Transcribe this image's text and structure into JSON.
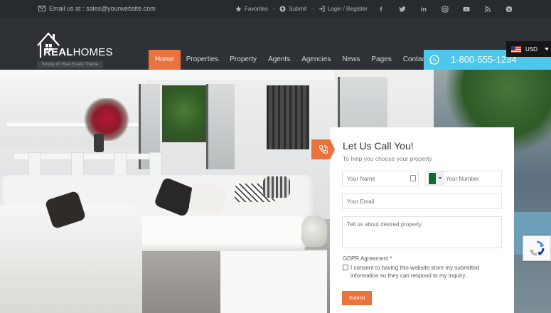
{
  "topbar": {
    "email_text": "Email us at : sales@yourwebsite.com",
    "links": [
      {
        "label": "Favorites",
        "icon": "star-icon"
      },
      {
        "label": "Submit",
        "icon": "plus-circle-icon"
      },
      {
        "label": "Login / Register",
        "icon": "login-icon"
      }
    ],
    "socials": [
      "facebook-icon",
      "twitter-icon",
      "linkedin-icon",
      "instagram-icon",
      "youtube-icon",
      "rss-icon",
      "skype-icon"
    ]
  },
  "header": {
    "logo_bold": "REAL",
    "logo_light": "HOMES",
    "tagline": "Simply #1 Real Estate Theme",
    "nav": [
      "Home",
      "Properties",
      "Property",
      "Agents",
      "Agencies",
      "News",
      "Pages",
      "Contact"
    ],
    "active_nav": "Home",
    "phone": "1-800-555-1234",
    "currency": "USD"
  },
  "form": {
    "title": "Let Us Call You!",
    "subtitle": "To help you choose your property",
    "name_placeholder": "Your Name",
    "number_placeholder": "Your Number",
    "email_placeholder": "Your Email",
    "message_placeholder": "Tell us about desired property",
    "gdpr_label": "GDPR Agreement *",
    "gdpr_text": "I consent to having this website store my submitted information so they can respond to my inquiry.",
    "submit_label": "Submit"
  },
  "colors": {
    "accent": "#ea723d",
    "phone_bg": "#4dc7ec",
    "header_bg": "#2e3236"
  }
}
